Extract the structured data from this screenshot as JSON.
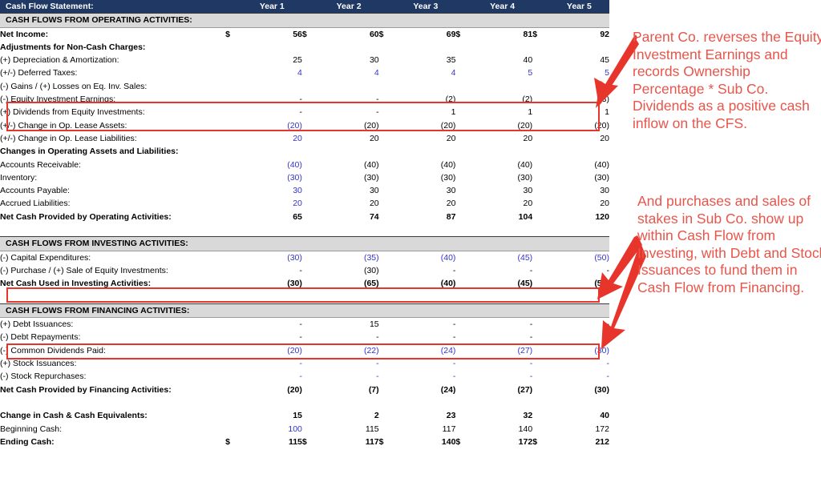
{
  "header": {
    "title": "Cash Flow Statement:",
    "years": [
      "Year 1",
      "Year 2",
      "Year 3",
      "Year 4",
      "Year 5"
    ]
  },
  "currency_symbol": "$",
  "colors": {
    "header_bg": "#1F3864",
    "band_bg": "#D9D9D9",
    "input_blue": "#3333CC",
    "annotation_red": "#E8554B",
    "box_red": "#E8352B"
  },
  "sections": {
    "operating": {
      "band": "CASH FLOWS FROM OPERATING ACTIVITIES:",
      "rows": [
        {
          "label": "Net Income:",
          "values": [
            "56",
            "60",
            "69",
            "81",
            "92"
          ]
        },
        {
          "label": "Adjustments for Non-Cash Charges:",
          "values": [
            "",
            "",
            "",
            "",
            ""
          ]
        },
        {
          "label": "(+) Depreciation & Amortization:",
          "values": [
            "25",
            "30",
            "35",
            "40",
            "45"
          ]
        },
        {
          "label": "(+/-) Deferred Taxes:",
          "values": [
            "4",
            "4",
            "4",
            "5",
            "5"
          ]
        },
        {
          "label": "(-) Gains / (+) Losses on Eq. Inv. Sales:",
          "values": [
            "",
            "",
            "",
            "",
            ""
          ]
        },
        {
          "label": "(-) Equity Investment Earnings:",
          "values": [
            "-",
            "-",
            "(2)",
            "(2)",
            "(3)"
          ]
        },
        {
          "label": "(+) Dividends from Equity Investments:",
          "values": [
            "-",
            "-",
            "1",
            "1",
            "1"
          ]
        },
        {
          "label": "(+/-) Change in Op. Lease Assets:",
          "values": [
            "(20)",
            "(20)",
            "(20)",
            "(20)",
            "(20)"
          ]
        },
        {
          "label": "(+/-) Change in Op. Lease Liabilities:",
          "values": [
            "20",
            "20",
            "20",
            "20",
            "20"
          ]
        },
        {
          "label": "Changes in Operating Assets and Liabilities:",
          "values": [
            "",
            "",
            "",
            "",
            ""
          ]
        },
        {
          "label": "Accounts Receivable:",
          "values": [
            "(40)",
            "(40)",
            "(40)",
            "(40)",
            "(40)"
          ]
        },
        {
          "label": "Inventory:",
          "values": [
            "(30)",
            "(30)",
            "(30)",
            "(30)",
            "(30)"
          ]
        },
        {
          "label": "Accounts Payable:",
          "values": [
            "30",
            "30",
            "30",
            "30",
            "30"
          ]
        },
        {
          "label": "Accrued Liabilities:",
          "values": [
            "20",
            "20",
            "20",
            "20",
            "20"
          ]
        }
      ],
      "total": {
        "label": "Net Cash Provided by Operating Activities:",
        "values": [
          "65",
          "74",
          "87",
          "104",
          "120"
        ]
      }
    },
    "investing": {
      "band": "CASH FLOWS FROM INVESTING ACTIVITIES:",
      "rows": [
        {
          "label": "(-) Capital Expenditures:",
          "values": [
            "(30)",
            "(35)",
            "(40)",
            "(45)",
            "(50)"
          ]
        },
        {
          "label": "(-) Purchase / (+) Sale of Equity Investments:",
          "values": [
            "-",
            "(30)",
            "-",
            "-",
            "-"
          ]
        }
      ],
      "total": {
        "label": "Net Cash Used in Investing Activities:",
        "values": [
          "(30)",
          "(65)",
          "(40)",
          "(45)",
          "(50)"
        ]
      }
    },
    "financing": {
      "band": "CASH FLOWS FROM FINANCING ACTIVITIES:",
      "rows": [
        {
          "label": "(+) Debt Issuances:",
          "values": [
            "-",
            "15",
            "-",
            "-",
            "-"
          ]
        },
        {
          "label": "(-) Debt Repayments:",
          "values": [
            "-",
            "-",
            "-",
            "-",
            "-"
          ]
        },
        {
          "label": "(-) Common Dividends Paid:",
          "values": [
            "(20)",
            "(22)",
            "(24)",
            "(27)",
            "(30)"
          ]
        },
        {
          "label": "(+) Stock Issuances:",
          "values": [
            "-",
            "-",
            "-",
            "-",
            "-"
          ]
        },
        {
          "label": "(-) Stock Repurchases:",
          "values": [
            "-",
            "-",
            "-",
            "-",
            "-"
          ]
        }
      ],
      "total": {
        "label": "Net Cash Provided by Financing Activities:",
        "values": [
          "(20)",
          "(7)",
          "(24)",
          "(27)",
          "(30)"
        ]
      }
    },
    "summary": {
      "change": {
        "label": "Change in Cash & Cash Equivalents:",
        "values": [
          "15",
          "2",
          "23",
          "32",
          "40"
        ]
      },
      "beginning": {
        "label": "Beginning Cash:",
        "values": [
          "100",
          "115",
          "117",
          "140",
          "172"
        ]
      },
      "ending": {
        "label": "Ending Cash:",
        "values": [
          "115",
          "117",
          "140",
          "172",
          "212"
        ]
      }
    }
  },
  "annotations": [
    {
      "id": "equity-earnings-note",
      "text": "Parent Co. reverses the Equity Investment Earnings and records Ownership Percentage * Sub Co. Dividends as a positive cash inflow on the CFS."
    },
    {
      "id": "investing-financing-note",
      "text": "And purchases and sales of stakes in Sub Co. show up within Cash Flow from Investing, with Debt and Stock Issuances to fund them in Cash Flow from Financing."
    }
  ]
}
